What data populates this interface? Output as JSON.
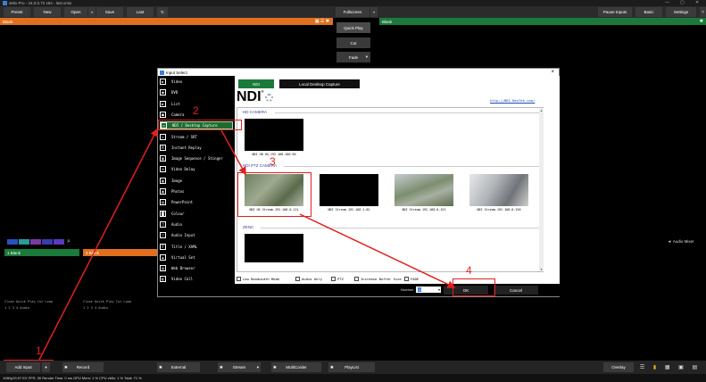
{
  "window": {
    "title": "vMix Pro - 24.0.0.72 x64 - last.vmix",
    "min": "—",
    "max": "▢",
    "close": "✕"
  },
  "menu": {
    "preset": "Preset",
    "new": "New",
    "open": "Open",
    "save": "Save",
    "last": "Last",
    "fullscreen": "Fullscreen",
    "pause_inputs": "Pause Inputs",
    "basic": "Basic",
    "settings": "Settings",
    "help": "?"
  },
  "preview": {
    "label": "Blank"
  },
  "output": {
    "label": "Blank"
  },
  "transitions": {
    "quick_play": "Quick Play",
    "cut": "Cut",
    "fade": "Fade"
  },
  "dialog": {
    "title": "Input Select",
    "close": "×",
    "categories": [
      {
        "label": "Video",
        "icon": "video-icon"
      },
      {
        "label": "DVD",
        "icon": "dvd-icon"
      },
      {
        "label": "List",
        "icon": "list-icon"
      },
      {
        "label": "Camera",
        "icon": "camera-icon"
      },
      {
        "label": "NDI / Desktop Capture",
        "icon": "monitor-icon"
      },
      {
        "label": "Stream / SRT",
        "icon": "stream-icon"
      },
      {
        "label": "Instant Replay",
        "icon": "replay-icon"
      },
      {
        "label": "Image Sequence / Stinger",
        "icon": "image-sequence-icon"
      },
      {
        "label": "Video Delay",
        "icon": "video-delay-icon"
      },
      {
        "label": "Image",
        "icon": "image-icon"
      },
      {
        "label": "Photos",
        "icon": "photos-icon"
      },
      {
        "label": "PowerPoint",
        "icon": "powerpoint-icon"
      },
      {
        "label": "Colour",
        "icon": "colour-icon"
      },
      {
        "label": "Audio",
        "icon": "audio-icon"
      },
      {
        "label": "Audio Input",
        "icon": "audio-input-icon"
      },
      {
        "label": "Title / XAML",
        "icon": "title-icon"
      },
      {
        "label": "Virtual Set",
        "icon": "virtual-set-icon"
      },
      {
        "label": "Web Browser",
        "icon": "web-browser-icon"
      },
      {
        "label": "Video Call",
        "icon": "video-call-icon"
      }
    ],
    "tabs": {
      "ndi": "NDI",
      "desktop": "Local Desktop Capture"
    },
    "ndi_logo": "NDI",
    "ndi_link": "http://NDI.NewTek.com/",
    "groups": {
      "hd_camera": "HD CAMERA",
      "ptz_camera": "NDI PTZ CAMERA",
      "zenc": "ZENC"
    },
    "sources": {
      "hd": "NDI HD HX,192.168.100.90",
      "ptz": [
        "NDI HX Stream-192.168.0.121",
        "NDI Stream-192.168.1.82",
        "NDI Stream-192.168.0.151",
        "NDI Stream-192.168.0.156"
      ]
    },
    "options": {
      "low_bandwidth": "Low Bandwidth Mode",
      "audio_only": "Audio Only",
      "ptz": "PTZ",
      "increase_buffer": "Increase Buffer Size",
      "fade": "FADE"
    },
    "number_label": "Number",
    "number_value": "1",
    "ok": "OK",
    "cancel": "Cancel"
  },
  "inputs": {
    "input1": "1  Blank",
    "input2": "2  Blank",
    "audio_mixer": "Audio Mixer"
  },
  "quickplay_rows": {
    "row1": "Close  Quick Play  Cut  Loop",
    "row1b": "Close  Quick Play  Cut  Loop",
    "nums": "1  2  3  4  Audio",
    "nums_b": "1  2  3  4  Audio"
  },
  "annotations": {
    "a1": "1",
    "a2": "2",
    "a3": "3",
    "a4": "4"
  },
  "bottom": {
    "add_input": "Add Input",
    "record": "Record",
    "external": "External",
    "stream": "Stream",
    "multicorder": "MultiCorder",
    "playlist": "PlayList",
    "overlay": "Overlay"
  },
  "status": {
    "text": "1080p29.97   EX FPS: 30  Render Time: 0 ms  GPU Mem: 1 %  CPU vMix: 1 %  Total: 71 %"
  },
  "colors": {
    "accent_orange": "#e07020",
    "accent_green": "#1b7a3a",
    "annotation_red": "#e02020"
  }
}
